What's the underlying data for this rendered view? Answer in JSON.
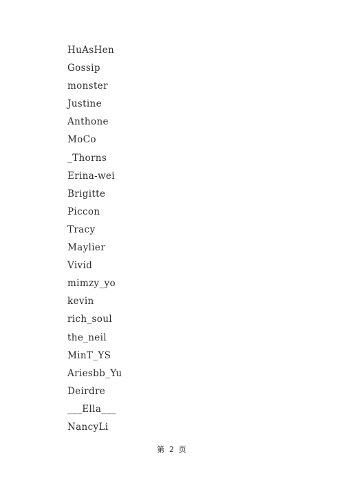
{
  "document": {
    "background_color": "#ffffff",
    "text_color": "#2c2c2c"
  },
  "name_list": {
    "items": [
      "HuAsHen",
      "Gossip",
      "monster",
      "Justine",
      "Anthone",
      "MoCo",
      "_Thorns",
      "Erina-wei",
      "Brigitte",
      "Piccon",
      "Tracy",
      "Maylier",
      "Vivid",
      "mimzy_yo",
      "kevin",
      "rich_soul",
      "the_neil",
      "MinT_YS",
      "Ariesbb_Yu",
      "Deirdre",
      "___Ella___",
      "NancyLi"
    ]
  },
  "footer": {
    "prefix": "第",
    "page_number": "2",
    "suffix": "页",
    "full_text": "第 2 页"
  }
}
